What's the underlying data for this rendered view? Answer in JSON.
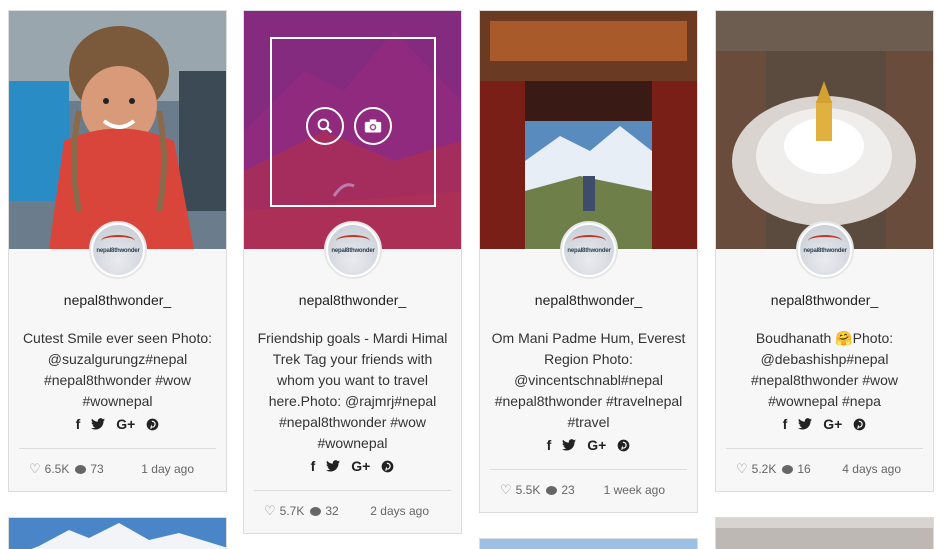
{
  "posts": [
    {
      "username": "nepal8thwonder_",
      "avatar_text": "nepal8thwonder",
      "caption": "Cutest Smile ever seen Photo: @suzalgurungz#nepal #nepal8thwonder #wow #wownepal",
      "likes": "6.5K",
      "comments": "73",
      "time": "1 day ago",
      "icons": [
        "facebook-icon",
        "twitter-icon",
        "google-plus-icon",
        "pinterest-icon"
      ]
    },
    {
      "username": "nepal8thwonder_",
      "avatar_text": "nepal8thwonder",
      "caption": "Friendship goals - Mardi Himal Trek Tag your friends with whom you want to travel here.Photo: @rajmrj#nepal #nepal8thwonder #wow #wownepal",
      "likes": "5.7K",
      "comments": "32",
      "time": "2 days ago",
      "icons": [
        "facebook-icon",
        "twitter-icon",
        "google-plus-icon",
        "pinterest-icon"
      ]
    },
    {
      "username": "nepal8thwonder_",
      "avatar_text": "nepal8thwonder",
      "caption": "Om Mani Padme Hum, Everest Region Photo: @vincentschnabl#nepal #nepal8thwonder #travelnepal #travel",
      "likes": "5.5K",
      "comments": "23",
      "time": "1 week ago",
      "icons": [
        "facebook-icon",
        "twitter-icon",
        "google-plus-icon",
        "pinterest-icon"
      ]
    },
    {
      "username": "nepal8thwonder_",
      "avatar_text": "nepal8thwonder",
      "caption": "Boudhanath 🤗Photo: @debashishp#nepal #nepal8thwonder #wow #wownepal #nepa",
      "likes": "5.2K",
      "comments": "16",
      "time": "4 days ago",
      "icons": [
        "facebook-icon",
        "twitter-icon",
        "google-plus-icon",
        "pinterest-icon"
      ]
    }
  ],
  "social_glyphs": {
    "facebook": "f",
    "twitter": "🐦",
    "google_plus": "G+",
    "pinterest": "P"
  },
  "overlay_buttons": [
    "search-icon",
    "camera-icon"
  ],
  "colors": {
    "overlay": "#961e78",
    "text": "#333333",
    "border": "#dcdcdc",
    "card_bg": "#f7f7f7"
  }
}
